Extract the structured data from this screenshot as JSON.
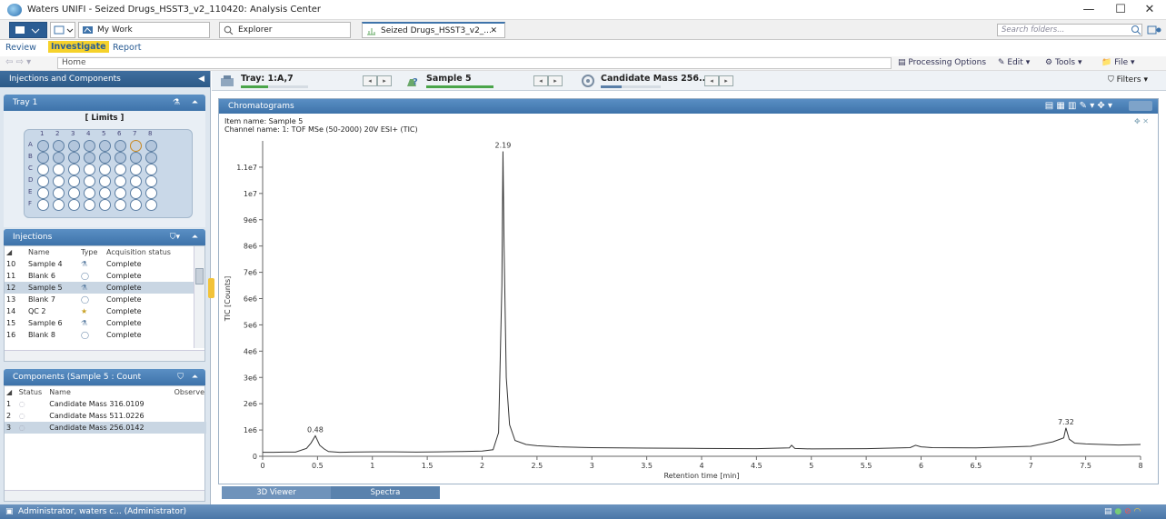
{
  "window": {
    "title": "Waters UNIFI - Seized Drugs_HSST3_v2_110420: Analysis Center",
    "controls": [
      "—",
      "☐",
      "✕"
    ]
  },
  "tabs": {
    "my_work": "My Work",
    "explorer": "Explorer",
    "document": "Seized Drugs_HSST3_v2_...",
    "search_placeholder": "Search folders..."
  },
  "nav": {
    "review": "Review",
    "investigate": "Investigate",
    "report": "Report",
    "home": "Home",
    "processing_options": "Processing Options",
    "edit": "Edit",
    "tools": "Tools",
    "file": "File"
  },
  "left": {
    "injections_components": "Injections and Components",
    "tray_title": "Tray 1",
    "limits": "[ Limits ]",
    "column_numbers": [
      "1",
      "2",
      "3",
      "4",
      "5",
      "6",
      "7",
      "8"
    ],
    "row_letters": [
      "A",
      "B",
      "C",
      "D",
      "E",
      "F"
    ],
    "injections_title": "Injections",
    "inj_headers": [
      "Name",
      "Type",
      "Acquisition status"
    ],
    "injections": [
      {
        "num": "10",
        "name": "Sample 4",
        "type": "sample",
        "status": "Complete"
      },
      {
        "num": "11",
        "name": "Blank 6",
        "type": "blank",
        "status": "Complete"
      },
      {
        "num": "12",
        "name": "Sample 5",
        "type": "sample",
        "status": "Complete"
      },
      {
        "num": "13",
        "name": "Blank 7",
        "type": "blank",
        "status": "Complete"
      },
      {
        "num": "14",
        "name": "QC 2",
        "type": "qc",
        "status": "Complete"
      },
      {
        "num": "15",
        "name": "Sample 6",
        "type": "sample",
        "status": "Complete"
      },
      {
        "num": "16",
        "name": "Blank 8",
        "type": "blank",
        "status": "Complete"
      }
    ],
    "components_title": "Components (Sample 5 : Count",
    "comp_headers": [
      "Status",
      "Name",
      "Observe"
    ],
    "components": [
      {
        "num": "1",
        "name": "Candidate Mass 316.0109"
      },
      {
        "num": "2",
        "name": "Candidate Mass 511.0226"
      },
      {
        "num": "3",
        "name": "Candidate Mass 256.0142"
      }
    ]
  },
  "toolbar": {
    "tray": "Tray: 1:A,7",
    "tray_progress": 0.4,
    "sample": "Sample 5",
    "sample_progress": 1.0,
    "candidate": "Candidate Mass 256....",
    "candidate_progress": 0.35,
    "filters": "Filters"
  },
  "chart_panel": {
    "title": "Chromatograms",
    "item_name": "Item name: Sample 5",
    "channel_name": "Channel name: 1: TOF MSe (50-2000) 20V ESI+ (TIC)"
  },
  "bottom_tabs": [
    "3D Viewer",
    "Spectra"
  ],
  "status_bar": {
    "user": "Administrator, waters c... (Administrator)"
  },
  "colors": {
    "accent": "#3e73aa",
    "investigate_highlight": "#f6d22b",
    "progress_green": "#4aa54a"
  },
  "chart_data": {
    "type": "line",
    "title": "",
    "xlabel": "Retention time [min]",
    "ylabel": "TIC [Counts]",
    "xlim": [
      0,
      8
    ],
    "ylim": [
      0,
      12000000
    ],
    "xticks": [
      0,
      0.5,
      1,
      1.5,
      2,
      2.5,
      3,
      3.5,
      4,
      4.5,
      5,
      5.5,
      6,
      6.5,
      7,
      7.5,
      8
    ],
    "xtick_labels": [
      "0",
      "0.5",
      "1",
      "1.5",
      "2",
      "2.5",
      "3",
      "3.5",
      "4",
      "4.5",
      "5",
      "5.5",
      "6",
      "6.5",
      "7",
      "7.5",
      "8"
    ],
    "yticks": [
      0,
      1000000,
      2000000,
      3000000,
      4000000,
      5000000,
      6000000,
      7000000,
      8000000,
      9000000,
      10000000,
      11000000
    ],
    "ytick_labels": [
      "0",
      "1e6",
      "2e6",
      "3e6",
      "4e6",
      "5e6",
      "6e6",
      "7e6",
      "8e6",
      "9e6",
      "1e7",
      "1.1e7"
    ],
    "annotations": [
      {
        "x": 0.48,
        "y": 780000,
        "label": "0.48"
      },
      {
        "x": 2.19,
        "y": 11600000,
        "label": "2.19"
      },
      {
        "x": 7.32,
        "y": 1080000,
        "label": "7.32"
      }
    ],
    "series": [
      {
        "x": [
          0,
          0.1,
          0.2,
          0.3,
          0.4,
          0.44,
          0.48,
          0.52,
          0.56,
          0.6,
          0.7,
          0.8,
          1.0,
          1.2,
          1.4,
          1.6,
          1.8,
          2.0,
          2.1,
          2.15,
          2.18,
          2.19,
          2.2,
          2.22,
          2.25,
          2.3,
          2.4,
          2.5,
          2.7,
          3.0,
          3.5,
          4.0,
          4.5,
          4.8,
          4.82,
          4.85,
          5.0,
          5.5,
          5.9,
          5.95,
          6.0,
          6.1,
          6.5,
          7.0,
          7.2,
          7.3,
          7.32,
          7.35,
          7.4,
          7.5,
          7.8,
          8.0
        ],
        "y": [
          150000,
          150000,
          160000,
          160000,
          300000,
          500000,
          780000,
          420000,
          280000,
          180000,
          150000,
          160000,
          170000,
          170000,
          160000,
          170000,
          180000,
          200000,
          250000,
          900000,
          6500000,
          11600000,
          8000000,
          3000000,
          1200000,
          600000,
          450000,
          400000,
          360000,
          330000,
          310000,
          300000,
          290000,
          320000,
          420000,
          300000,
          280000,
          290000,
          330000,
          420000,
          360000,
          330000,
          320000,
          380000,
          550000,
          700000,
          1080000,
          650000,
          500000,
          470000,
          430000,
          450000
        ]
      }
    ]
  }
}
